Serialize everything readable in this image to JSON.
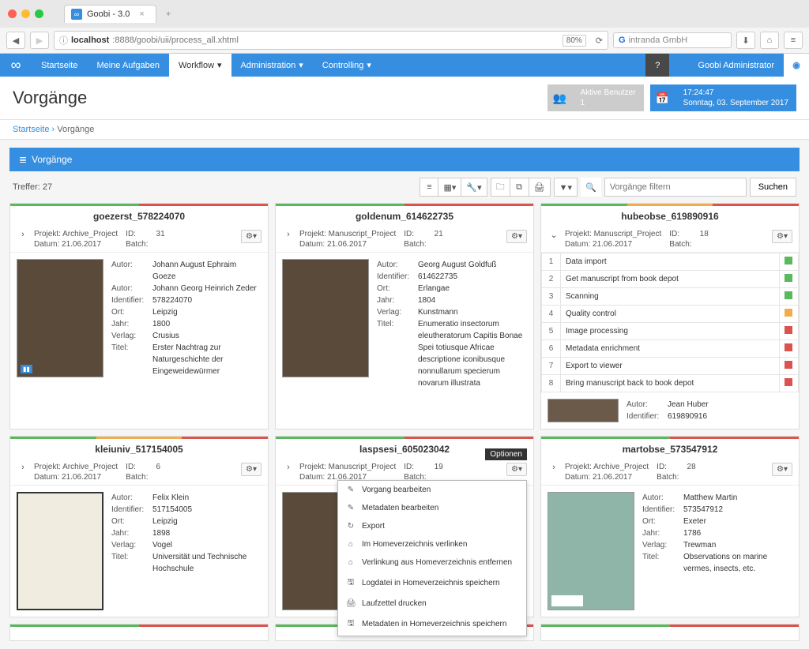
{
  "browser": {
    "tab_title": "Goobi - 3.0",
    "url_host": "localhost",
    "url_path": ":8888/goobi/uii/process_all.xhtml",
    "zoom": "80%",
    "search_placeholder": "intranda GmbH"
  },
  "nav": {
    "items": [
      "Startseite",
      "Meine Aufgaben",
      "Workflow",
      "Administration",
      "Controlling"
    ],
    "active_index": 2,
    "help": "?",
    "user": "Goobi Administrator"
  },
  "header": {
    "title": "Vorgänge",
    "active_users_label": "Aktive Benutzer",
    "active_users_count": "1",
    "time": "17:24:47",
    "date": "Sonntag, 03. September 2017"
  },
  "breadcrumb": {
    "home": "Startseite",
    "sep": "›",
    "current": "Vorgänge"
  },
  "panel_title": "Vorgänge",
  "toolbar": {
    "hits_label": "Treffer:",
    "hits_count": "27",
    "filter_placeholder": "Vorgänge filtern",
    "search_btn": "Suchen"
  },
  "labels": {
    "projekt": "Projekt:",
    "datum": "Datum:",
    "id": "ID:",
    "batch": "Batch:",
    "autor": "Autor:",
    "identifier": "Identifier:",
    "ort": "Ort:",
    "jahr": "Jahr:",
    "verlag": "Verlag:",
    "titel": "Titel:"
  },
  "cards": [
    {
      "name": "goezerst_578224070",
      "project": "Archive_Project",
      "date": "21.06.2017",
      "id": "31",
      "batch": "",
      "status_colors": [
        "#5cb85c",
        "#d9534f"
      ],
      "details": [
        {
          "k": "Autor:",
          "v": "Johann August Ephraim Goeze"
        },
        {
          "k": "Autor:",
          "v": "Johann Georg Heinrich Zeder"
        },
        {
          "k": "Identifier:",
          "v": "578224070"
        },
        {
          "k": "Ort:",
          "v": "Leipzig"
        },
        {
          "k": "Jahr:",
          "v": "1800"
        },
        {
          "k": "Verlag:",
          "v": "Crusius"
        },
        {
          "k": "Titel:",
          "v": "Erster Nachtrag zur Naturgeschichte der Eingeweidewürmer"
        }
      ]
    },
    {
      "name": "goldenum_614622735",
      "project": "Manuscript_Project",
      "date": "21.06.2017",
      "id": "21",
      "batch": "",
      "status_colors": [
        "#5cb85c",
        "#d9534f"
      ],
      "details": [
        {
          "k": "Autor:",
          "v": "Georg August Goldfuß"
        },
        {
          "k": "Identifier:",
          "v": "614622735"
        },
        {
          "k": "Ort:",
          "v": "Erlangae"
        },
        {
          "k": "Jahr:",
          "v": "1804"
        },
        {
          "k": "Verlag:",
          "v": "Kunstmann"
        },
        {
          "k": "Titel:",
          "v": "Enumeratio insectorum eleutheratorum Capitis Bonae Spei totiusque Africae descriptione iconibusque nonnullarum specierum novarum illustrata"
        }
      ]
    },
    {
      "name": "hubeobse_619890916",
      "project": "Manuscript_Project",
      "date": "21.06.2017",
      "id": "18",
      "batch": "",
      "status_colors": [
        "#5cb85c",
        "#f0ad4e",
        "#d9534f"
      ],
      "expanded": true,
      "steps": [
        {
          "n": "1",
          "t": "Data import",
          "s": "g"
        },
        {
          "n": "2",
          "t": "Get manuscript from book depot",
          "s": "g"
        },
        {
          "n": "3",
          "t": "Scanning",
          "s": "g"
        },
        {
          "n": "4",
          "t": "Quality control",
          "s": "y"
        },
        {
          "n": "5",
          "t": "Image processing",
          "s": "r"
        },
        {
          "n": "6",
          "t": "Metadata enrichment",
          "s": "r"
        },
        {
          "n": "7",
          "t": "Export to viewer",
          "s": "r"
        },
        {
          "n": "8",
          "t": "Bring manuscript back to book depot",
          "s": "r"
        }
      ],
      "bottom": [
        {
          "k": "Autor:",
          "v": "Jean Huber"
        },
        {
          "k": "Identifier:",
          "v": "619890916"
        }
      ]
    },
    {
      "name": "kleiuniv_517154005",
      "project": "Archive_Project",
      "date": "21.06.2017",
      "id": "6",
      "batch": "",
      "status_colors": [
        "#5cb85c",
        "#f0ad4e",
        "#d9534f"
      ],
      "thumb_style": "paper",
      "details": [
        {
          "k": "Autor:",
          "v": "Felix Klein"
        },
        {
          "k": "Identifier:",
          "v": "517154005"
        },
        {
          "k": "Ort:",
          "v": "Leipzig"
        },
        {
          "k": "Jahr:",
          "v": "1898"
        },
        {
          "k": "Verlag:",
          "v": "Vogel"
        },
        {
          "k": "Titel:",
          "v": "Universität und Technische Hochschule"
        }
      ]
    },
    {
      "name": "laspsesi_605023042",
      "project": "Manuscript_Project",
      "date": "21.06.2017",
      "id": "19",
      "batch": "",
      "status_colors": [
        "#5cb85c",
        "#d9534f"
      ],
      "dropdown_open": true
    },
    {
      "name": "martobse_573547912",
      "project": "Archive_Project",
      "date": "21.06.2017",
      "id": "28",
      "batch": "",
      "status_colors": [
        "#5cb85c",
        "#d9534f"
      ],
      "thumb_style": "teal",
      "details": [
        {
          "k": "Autor:",
          "v": "Matthew Martin"
        },
        {
          "k": "Identifier:",
          "v": "573547912"
        },
        {
          "k": "Ort:",
          "v": "Exeter"
        },
        {
          "k": "Jahr:",
          "v": "1786"
        },
        {
          "k": "Verlag:",
          "v": "Trewman"
        },
        {
          "k": "Titel:",
          "v": "Observations on marine vermes, insects, etc."
        }
      ]
    }
  ],
  "dropdown": {
    "tooltip": "Optionen",
    "items": [
      {
        "icon": "✎",
        "label": "Vorgang bearbeiten"
      },
      {
        "icon": "✎",
        "label": "Metadaten bearbeiten"
      },
      {
        "icon": "↻",
        "label": "Export"
      },
      {
        "icon": "⌂",
        "label": "Im Homeverzeichnis verlinken"
      },
      {
        "icon": "⌂",
        "label": "Verlinkung aus Homeverzeichnis entfernen"
      },
      {
        "icon": "🖫",
        "label": "Logdatei in Homeverzeichnis speichern"
      },
      {
        "icon": "🖨",
        "label": "Laufzettel drucken"
      },
      {
        "icon": "🖫",
        "label": "Metadaten in Homeverzeichnis speichern"
      }
    ]
  }
}
